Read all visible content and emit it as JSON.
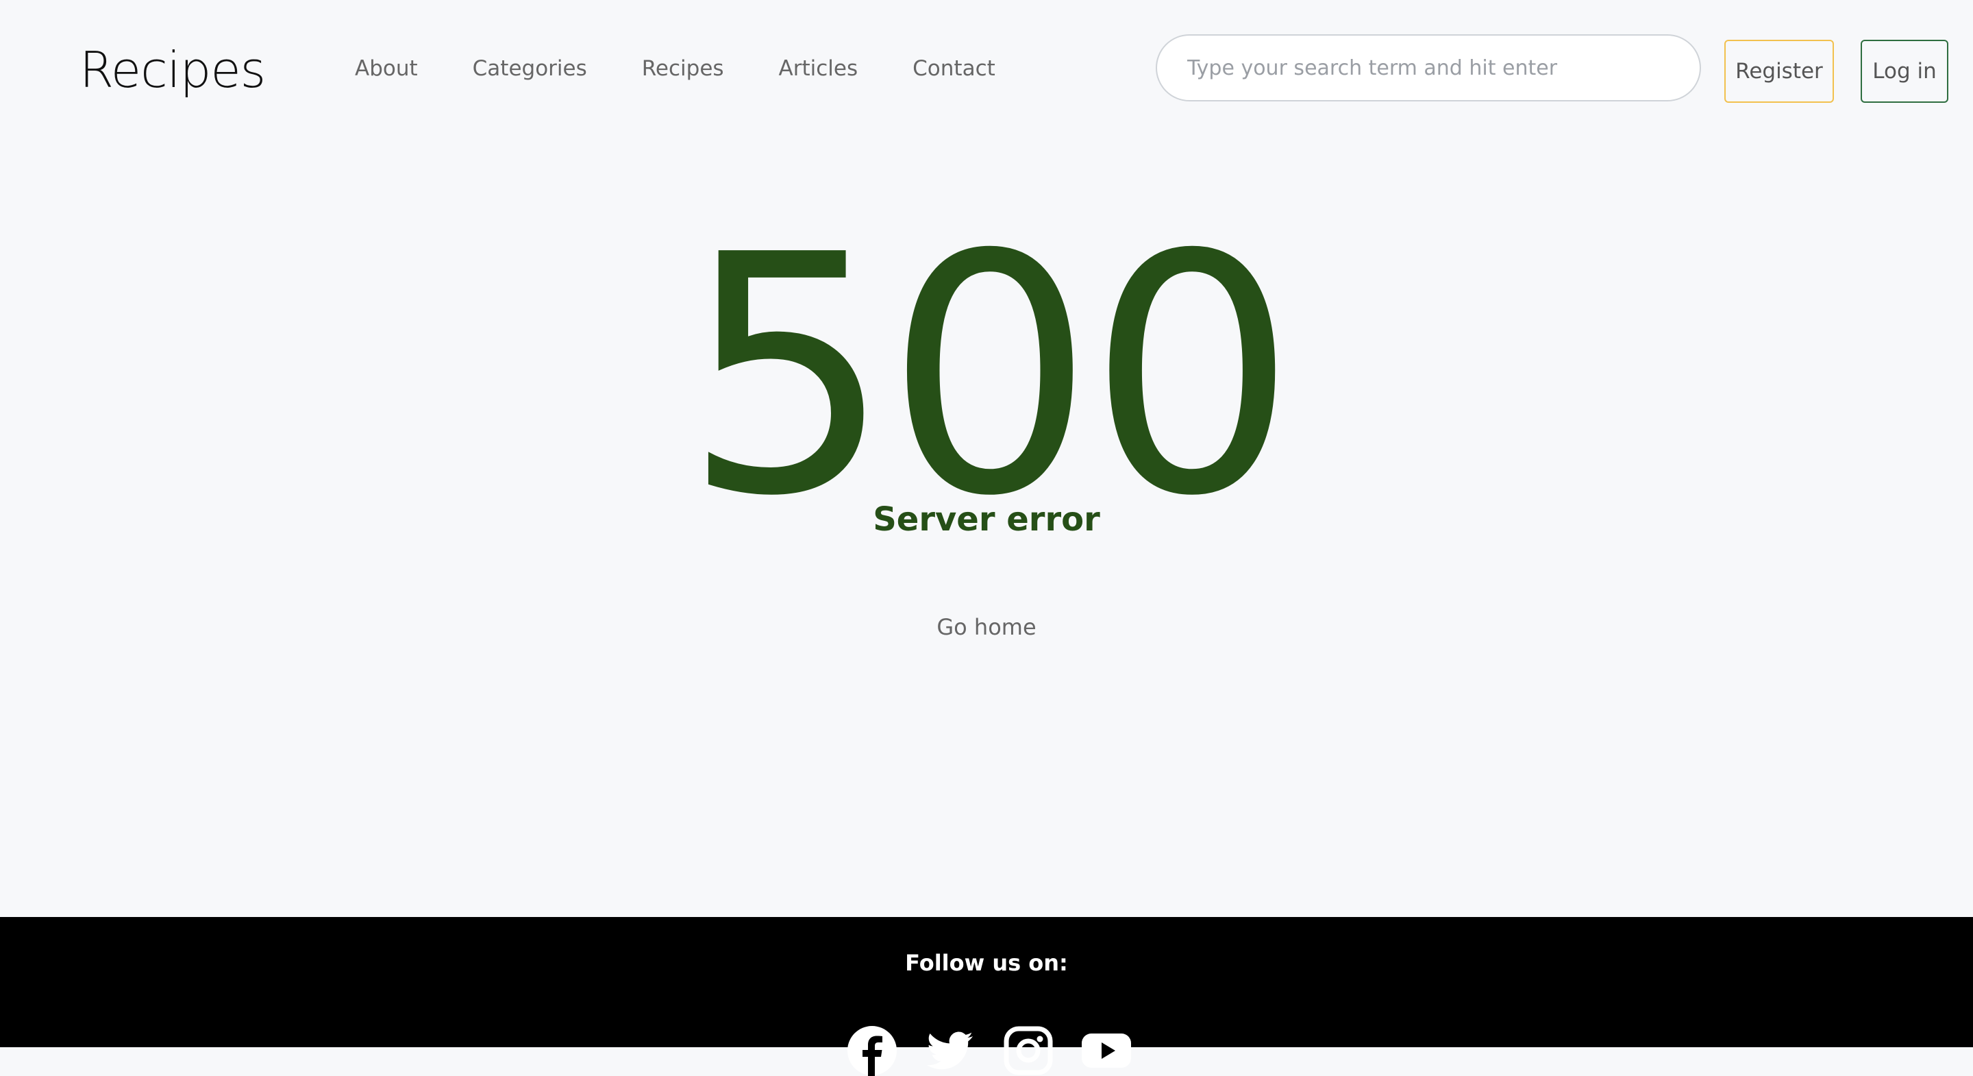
{
  "header": {
    "logo": "Recipes",
    "nav": [
      "About",
      "Categories",
      "Recipes",
      "Articles",
      "Contact"
    ],
    "search_placeholder": "Type your search term and hit enter",
    "register_label": "Register",
    "login_label": "Log in"
  },
  "main": {
    "code": "500",
    "message": "Server error",
    "go_home": "Go home"
  },
  "footer": {
    "follow_label": "Follow us on:",
    "socials": [
      "facebook-icon",
      "twitter-icon",
      "instagram-icon",
      "youtube-icon"
    ]
  },
  "colors": {
    "accent_green": "#264f17",
    "register_border": "#f2c14e",
    "login_border": "#2f6e40"
  }
}
